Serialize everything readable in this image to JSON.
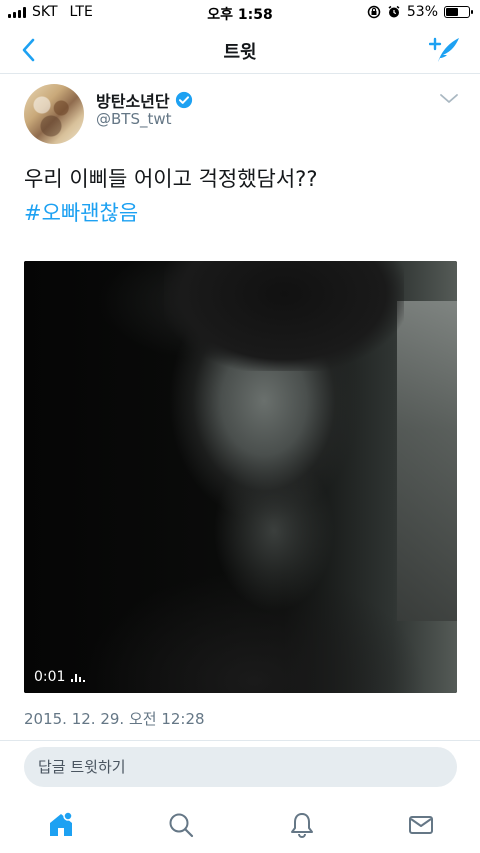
{
  "status_bar": {
    "carrier": "SKT",
    "network": "LTE",
    "time": "오후 1:58",
    "battery": "53%",
    "battery_fraction": 0.53
  },
  "nav": {
    "title": "트윗",
    "back_icon": "chevron-left-icon",
    "compose_icon": "compose-tweet-icon"
  },
  "tweet": {
    "display_name": "방탄소년단",
    "handle": "@BTS_twt",
    "text": "우리 이삐들 어이고 걱정했담서??",
    "hashtag": "#오빠괜찮음",
    "video_time": "0:01",
    "timestamp": "2015. 12. 29. 오전 12:28"
  },
  "reply": {
    "placeholder": "답글 트윗하기"
  },
  "tabs": [
    {
      "name": "home",
      "icon": "home-icon"
    },
    {
      "name": "search",
      "icon": "search-icon"
    },
    {
      "name": "notifications",
      "icon": "bell-icon"
    },
    {
      "name": "messages",
      "icon": "envelope-icon"
    }
  ],
  "colors": {
    "accent": "#1da1f2",
    "secondary_text": "#657786",
    "divider": "#e1e8ed"
  }
}
